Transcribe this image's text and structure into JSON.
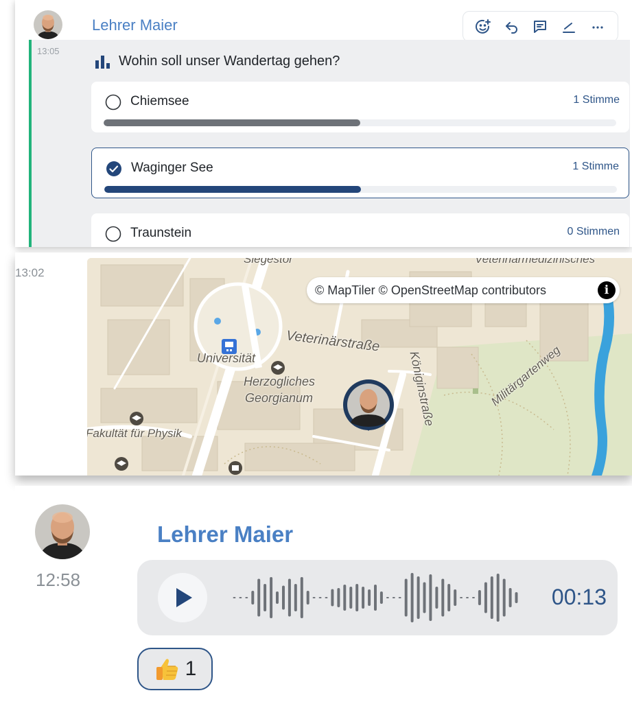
{
  "poll_message": {
    "sender": "Lehrer Maier",
    "time": "13:05",
    "question": "Wohin soll unser Wandertag gehen?",
    "toolbar": [
      "add-reaction",
      "reply",
      "thread",
      "edit",
      "more"
    ],
    "options": [
      {
        "label": "Chiemsee",
        "votes": "1 Stimme",
        "share": 0.5,
        "selected": false
      },
      {
        "label": "Waginger See",
        "votes": "1 Stimme",
        "share": 0.5,
        "selected": true
      },
      {
        "label": "Traunstein",
        "votes": "0 Stimmen",
        "share": 0,
        "selected": false
      }
    ]
  },
  "location_message": {
    "time": "13:02",
    "attribution": "© MapTiler © OpenStreetMap contributors",
    "labels": {
      "siegestor": "Siegestor",
      "tiermed": "Veterinärmedizinisches",
      "veterinaerstrasse": "Veterinärstraße",
      "universitaet": "Universität",
      "herzogliches": "Herzogliches",
      "georgianum": "Georgianum",
      "koeniginstrasse": "Königinstraße",
      "militaergartenweg": "Militärgartenweg",
      "fakultaet": "Fakultät für Physik"
    }
  },
  "voice_message": {
    "sender": "Lehrer Maier",
    "time": "12:58",
    "duration": "00:13",
    "waveform": [
      2,
      2,
      2,
      20,
      55,
      40,
      60,
      18,
      35,
      55,
      40,
      60,
      20,
      2,
      2,
      2,
      25,
      28,
      38,
      32,
      40,
      32,
      24,
      38,
      18,
      2,
      2,
      2,
      55,
      72,
      62,
      45,
      68,
      32,
      55,
      40,
      24,
      2,
      2,
      2,
      22,
      45,
      62,
      70,
      55,
      28,
      16
    ],
    "reaction": {
      "emoji": "thumbs-up",
      "count": "1"
    }
  },
  "colors": {
    "accent": "#2e5588",
    "name": "#4a80c4",
    "thread_line": "#21b37b",
    "bar_grey": "#6e7278",
    "bar_blue": "#23467a"
  }
}
